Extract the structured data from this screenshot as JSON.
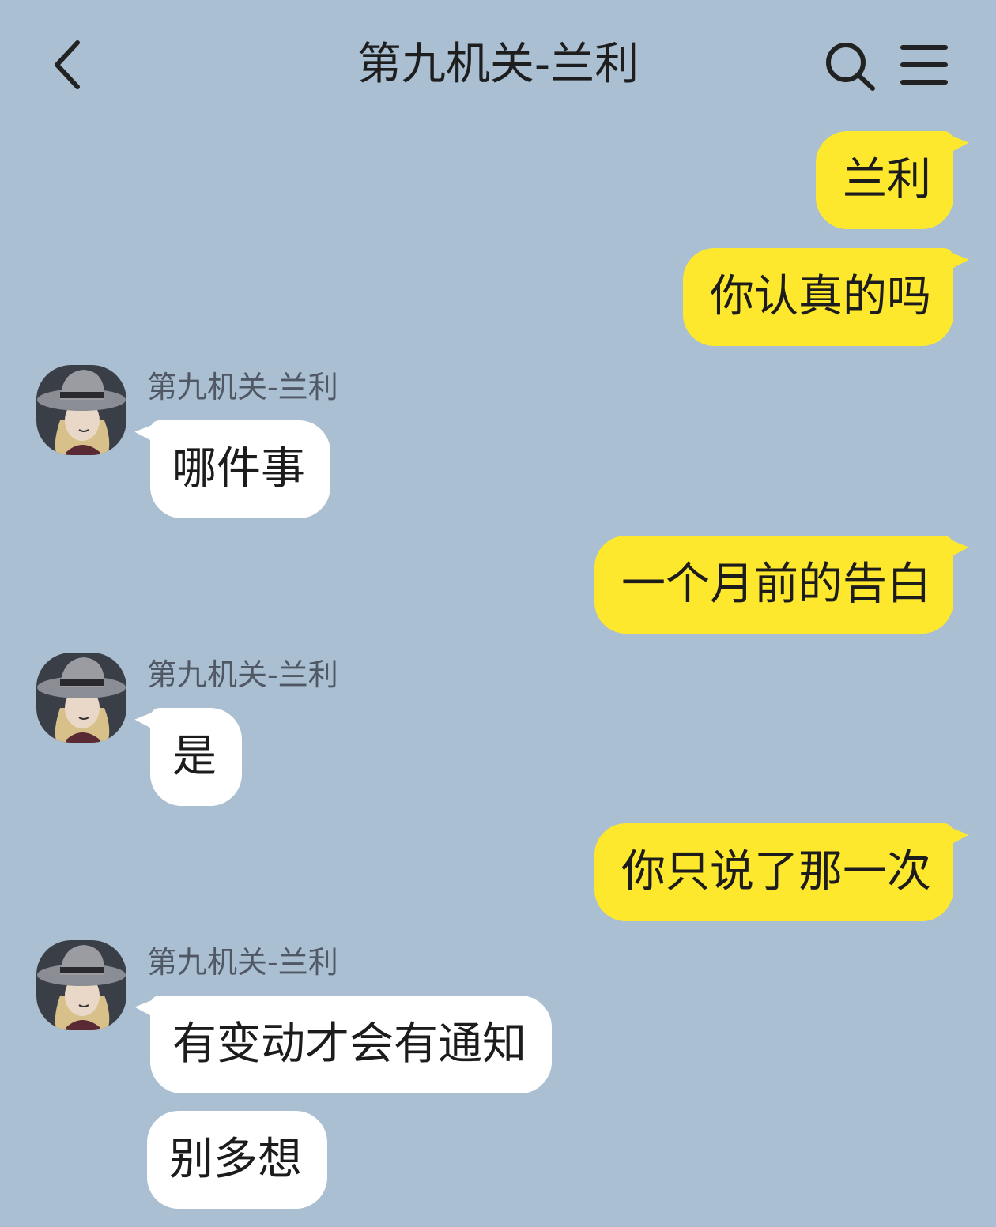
{
  "header": {
    "title": "第九机关-兰利",
    "back_icon": "chevron-left-icon",
    "search_icon": "search-icon",
    "menu_icon": "hamburger-menu-icon"
  },
  "colors": {
    "background": "#aabfd1",
    "outgoing_bubble": "#fee82e",
    "incoming_bubble": "#ffffff",
    "sender_name": "#4f5864"
  },
  "messages": [
    {
      "direction": "outgoing",
      "text": "兰利"
    },
    {
      "direction": "outgoing",
      "text": "你认真的吗"
    },
    {
      "direction": "incoming",
      "sender": "第九机关-兰利",
      "text": "哪件事"
    },
    {
      "direction": "outgoing",
      "text": "一个月前的告白"
    },
    {
      "direction": "incoming",
      "sender": "第九机关-兰利",
      "text": "是"
    },
    {
      "direction": "outgoing",
      "text": "你只说了那一次"
    },
    {
      "direction": "incoming",
      "sender": "第九机关-兰利",
      "text": "有变动才会有通知"
    },
    {
      "direction": "incoming",
      "text": "别多想"
    }
  ]
}
